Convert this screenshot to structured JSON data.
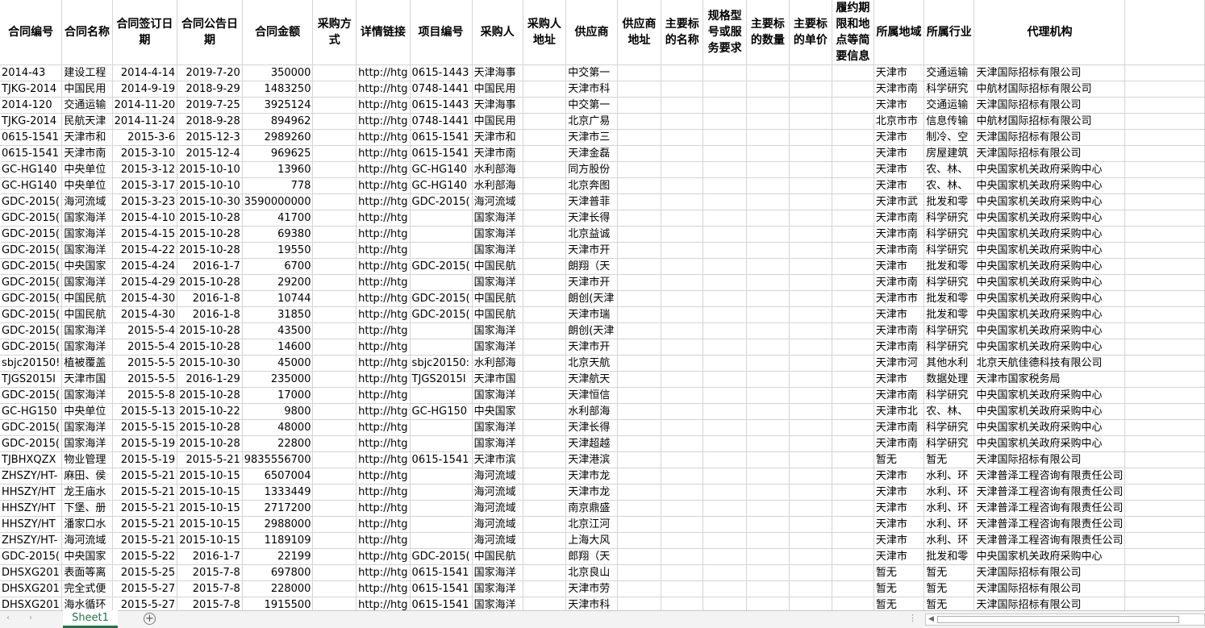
{
  "headers": [
    "合同编号",
    "合同名称",
    "合同签订日期",
    "合同公告日期",
    "合同金额",
    "采购方式",
    "详情链接",
    "项目编号",
    "采购人",
    "采购人地址",
    "供应商",
    "供应商地址",
    "主要标的名称",
    "规格型号或服务要求",
    "主要标的数量",
    "主要标的单价",
    "履约期限和地点等简要信息",
    "所属地域",
    "所属行业",
    "代理机构"
  ],
  "rows": [
    [
      "2014-43",
      "建设工程",
      "2014-4-14",
      "2019-7-20",
      "350000",
      "",
      "http://htg",
      "0615-1443",
      "天津海事",
      "",
      "中交第一",
      "",
      "",
      "",
      "",
      "",
      "",
      "天津市",
      "交通运输",
      "天津国际招标有限公司"
    ],
    [
      "TJKG-2014",
      "中国民用",
      "2014-9-19",
      "2018-9-29",
      "1483250",
      "",
      "http://htg",
      "0748-1441",
      "中国民用",
      "",
      "天津市科",
      "",
      "",
      "",
      "",
      "",
      "",
      "天津市南",
      "科学研究",
      "中航材国际招标有限公司"
    ],
    [
      "2014-120",
      "交通运输",
      "2014-11-20",
      "2019-7-25",
      "3925124",
      "",
      "http://htg",
      "0615-1443",
      "天津海事",
      "",
      "中交第一",
      "",
      "",
      "",
      "",
      "",
      "",
      "天津市",
      "交通运输",
      "天津国际招标有限公司"
    ],
    [
      "TJKG-2014",
      "民航天津",
      "2014-11-24",
      "2018-9-28",
      "894962",
      "",
      "http://htg",
      "0748-1441",
      "中国民用",
      "",
      "北京广易",
      "",
      "",
      "",
      "",
      "",
      "",
      "北京市市",
      "信息传输",
      "中航材国际招标有限公司"
    ],
    [
      "0615-1541",
      "天津市和",
      "2015-3-6",
      "2015-12-3",
      "2989260",
      "",
      "http://htg",
      "0615-1541",
      "天津市和",
      "",
      "天津市三",
      "",
      "",
      "",
      "",
      "",
      "",
      "天津市",
      "制冷、空",
      "天津国际招标有限公司"
    ],
    [
      "0615-1541",
      "天津市南",
      "2015-3-10",
      "2015-12-4",
      "969625",
      "",
      "http://htg",
      "0615-1541",
      "天津市南",
      "",
      "天津金磊",
      "",
      "",
      "",
      "",
      "",
      "",
      "天津市",
      "房屋建筑",
      "天津国际招标有限公司"
    ],
    [
      "GC-HG140",
      "中央单位",
      "2015-3-12",
      "2015-10-10",
      "13960",
      "",
      "http://htg",
      "GC-HG140",
      "水利部海",
      "",
      "同方股份",
      "",
      "",
      "",
      "",
      "",
      "",
      "天津市",
      "农、林、",
      "中央国家机关政府采购中心"
    ],
    [
      "GC-HG140",
      "中央单位",
      "2015-3-17",
      "2015-10-10",
      "778",
      "",
      "http://htg",
      "GC-HG140",
      "水利部海",
      "",
      "北京奔图",
      "",
      "",
      "",
      "",
      "",
      "",
      "天津市",
      "农、林、",
      "中央国家机关政府采购中心"
    ],
    [
      "GDC-2015(",
      "海河流域",
      "2015-3-23",
      "2015-10-30",
      "3590000000",
      "",
      "http://htg",
      "GDC-2015(",
      "海河流域",
      "",
      "天津普菲",
      "",
      "",
      "",
      "",
      "",
      "",
      "天津市武",
      "批发和零",
      "中央国家机关政府采购中心"
    ],
    [
      "GDC-2015(",
      "国家海洋",
      "2015-4-10",
      "2015-10-28",
      "41700",
      "",
      "http://htg",
      "",
      "国家海洋",
      "",
      "天津长得",
      "",
      "",
      "",
      "",
      "",
      "",
      "天津市南",
      "科学研究",
      "中央国家机关政府采购中心"
    ],
    [
      "GDC-2015(",
      "国家海洋",
      "2015-4-15",
      "2015-10-28",
      "69380",
      "",
      "http://htg",
      "",
      "国家海洋",
      "",
      "北京益诚",
      "",
      "",
      "",
      "",
      "",
      "",
      "天津市南",
      "科学研究",
      "中央国家机关政府采购中心"
    ],
    [
      "GDC-2015(",
      "国家海洋",
      "2015-4-22",
      "2015-10-28",
      "19550",
      "",
      "http://htg",
      "",
      "国家海洋",
      "",
      "天津市开",
      "",
      "",
      "",
      "",
      "",
      "",
      "天津市南",
      "科学研究",
      "中央国家机关政府采购中心"
    ],
    [
      "GDC-2015(",
      "中央国家",
      "2015-4-24",
      "2016-1-7",
      "6700",
      "",
      "http://htg",
      "GDC-2015(",
      "中国民航",
      "",
      "朗翔（天",
      "",
      "",
      "",
      "",
      "",
      "",
      "天津市",
      "批发和零",
      "中央国家机关政府采购中心"
    ],
    [
      "GDC-2015(",
      "国家海洋",
      "2015-4-29",
      "2015-10-28",
      "29200",
      "",
      "http://htg",
      "",
      "国家海洋",
      "",
      "天津市开",
      "",
      "",
      "",
      "",
      "",
      "",
      "天津市南",
      "科学研究",
      "中央国家机关政府采购中心"
    ],
    [
      "GDC-2015(",
      "中国民航",
      "2015-4-30",
      "2016-1-8",
      "10744",
      "",
      "http://htg",
      "GDC-2015(",
      "中国民航",
      "",
      "朗创(天津",
      "",
      "",
      "",
      "",
      "",
      "",
      "天津市市",
      "批发和零",
      "中央国家机关政府采购中心"
    ],
    [
      "GDC-2015(",
      "中国民航",
      "2015-4-30",
      "2016-1-8",
      "31850",
      "",
      "http://htg",
      "GDC-2015(",
      "中国民航",
      "",
      "天津市瑞",
      "",
      "",
      "",
      "",
      "",
      "",
      "天津市",
      "批发和零",
      "中央国家机关政府采购中心"
    ],
    [
      "GDC-2015(",
      "国家海洋",
      "2015-5-4",
      "2015-10-28",
      "43500",
      "",
      "http://htg",
      "",
      "国家海洋",
      "",
      "朗创(天津",
      "",
      "",
      "",
      "",
      "",
      "",
      "天津市南",
      "科学研究",
      "中央国家机关政府采购中心"
    ],
    [
      "GDC-2015(",
      "国家海洋",
      "2015-5-4",
      "2015-10-28",
      "14600",
      "",
      "http://htg",
      "",
      "国家海洋",
      "",
      "天津市开",
      "",
      "",
      "",
      "",
      "",
      "",
      "天津市南",
      "科学研究",
      "中央国家机关政府采购中心"
    ],
    [
      "sbjc20150!",
      "植被覆盖",
      "2015-5-5",
      "2015-10-30",
      "45000",
      "",
      "http://htg",
      "sbjc20150:",
      "水利部海",
      "",
      "北京天航",
      "",
      "",
      "",
      "",
      "",
      "",
      "天津市河",
      "其他水利",
      "北京天航佳德科技有限公司"
    ],
    [
      "TJGS2015I",
      "天津市国",
      "2015-5-5",
      "2016-1-29",
      "235000",
      "",
      "http://htg",
      "TJGS2015I",
      "天津市国",
      "",
      "天津航天",
      "",
      "",
      "",
      "",
      "",
      "",
      "天津市",
      "数据处理",
      "天津市国家税务局"
    ],
    [
      "GDC-2015(",
      "国家海洋",
      "2015-5-8",
      "2015-10-28",
      "17000",
      "",
      "http://htg",
      "",
      "国家海洋",
      "",
      "天津恒信",
      "",
      "",
      "",
      "",
      "",
      "",
      "天津市南",
      "科学研究",
      "中央国家机关政府采购中心"
    ],
    [
      "GC-HG150",
      "中央单位",
      "2015-5-13",
      "2015-10-22",
      "9800",
      "",
      "http://htg",
      "GC-HG150",
      "中央国家",
      "",
      "水利部海",
      "",
      "",
      "",
      "",
      "",
      "",
      "天津市北",
      "农、林、",
      "中央国家机关政府采购中心"
    ],
    [
      "GDC-2015(",
      "国家海洋",
      "2015-5-15",
      "2015-10-28",
      "48000",
      "",
      "http://htg",
      "",
      "国家海洋",
      "",
      "天津长得",
      "",
      "",
      "",
      "",
      "",
      "",
      "天津市南",
      "科学研究",
      "中央国家机关政府采购中心"
    ],
    [
      "GDC-2015(",
      "国家海洋",
      "2015-5-19",
      "2015-10-28",
      "22800",
      "",
      "http://htg",
      "",
      "国家海洋",
      "",
      "天津超越",
      "",
      "",
      "",
      "",
      "",
      "",
      "天津市南",
      "科学研究",
      "中央国家机关政府采购中心"
    ],
    [
      "TJBHXQZX",
      "物业管理",
      "2015-5-19",
      "2015-5-21",
      "9835556700",
      "",
      "http://htg",
      "0615-1541",
      "天津市滨",
      "",
      "天津港滨",
      "",
      "",
      "",
      "",
      "",
      "",
      "暂无",
      "暂无",
      "天津国际招标有限公司"
    ],
    [
      "ZHSZY/HT-",
      "麻田、侯",
      "2015-5-21",
      "2015-10-15",
      "6507004",
      "",
      "http://htg",
      "",
      "海河流域",
      "",
      "天津市龙",
      "",
      "",
      "",
      "",
      "",
      "",
      "天津市",
      "水利、环",
      "天津普泽工程咨询有限责任公司"
    ],
    [
      "HHSZY/HT",
      "龙王庙水",
      "2015-5-21",
      "2015-10-15",
      "1333449",
      "",
      "http://htg",
      "",
      "海河流域",
      "",
      "天津市龙",
      "",
      "",
      "",
      "",
      "",
      "",
      "天津市",
      "水利、环",
      "天津普泽工程咨询有限责任公司"
    ],
    [
      "HHSZY/HT",
      "下堡、册",
      "2015-5-21",
      "2015-10-15",
      "2717200",
      "",
      "http://htg",
      "",
      "海河流域",
      "",
      "南京鼎盛",
      "",
      "",
      "",
      "",
      "",
      "",
      "天津市",
      "水利、环",
      "天津普泽工程咨询有限责任公司"
    ],
    [
      "HHSZY/HT",
      "潘家口水",
      "2015-5-21",
      "2015-10-15",
      "2988000",
      "",
      "http://htg",
      "",
      "海河流域",
      "",
      "北京江河",
      "",
      "",
      "",
      "",
      "",
      "",
      "天津市",
      "水利、环",
      "天津普泽工程咨询有限责任公司"
    ],
    [
      "ZHSZY/HT-",
      "海河流域",
      "2015-5-21",
      "2015-10-15",
      "1189109",
      "",
      "http://htg",
      "",
      "海河流域",
      "",
      "上海大风",
      "",
      "",
      "",
      "",
      "",
      "",
      "天津市",
      "水利、环",
      "天津普泽工程咨询有限责任公司"
    ],
    [
      "GDC-2015(",
      "中央国家",
      "2015-5-22",
      "2016-1-7",
      "22199",
      "",
      "http://htg",
      "GDC-2015(",
      "中国民航",
      "",
      "郎翔（天",
      "",
      "",
      "",
      "",
      "",
      "",
      "天津市",
      "批发和零",
      "中央国家机关政府采购中心"
    ],
    [
      "DHSXG201",
      "表面等离",
      "2015-5-25",
      "2015-7-8",
      "697800",
      "",
      "http://htg",
      "0615-1541",
      "国家海洋",
      "",
      "北京良山",
      "",
      "",
      "",
      "",
      "",
      "",
      "暂无",
      "暂无",
      "天津国际招标有限公司"
    ],
    [
      "DHSXG201",
      "完全式便",
      "2015-5-27",
      "2015-7-8",
      "228000",
      "",
      "http://htg",
      "0615-1541",
      "国家海洋",
      "",
      "天津市劳",
      "",
      "",
      "",
      "",
      "",
      "",
      "暂无",
      "暂无",
      "天津国际招标有限公司"
    ],
    [
      "DHSXG201",
      "海水循环",
      "2015-5-27",
      "2015-7-8",
      "1915500",
      "",
      "http://htg",
      "0615-1541",
      "国家海洋",
      "",
      "天津市科",
      "",
      "",
      "",
      "",
      "",
      "",
      "暂无",
      "暂无",
      "天津国际招标有限公司"
    ]
  ],
  "sheet_tab": "Sheet1",
  "add_sheet_symbol": "+",
  "tabbar": {
    "nav_left": "‹",
    "nav_right": "›",
    "dots": "⋮",
    "scroll_left": "◀"
  }
}
